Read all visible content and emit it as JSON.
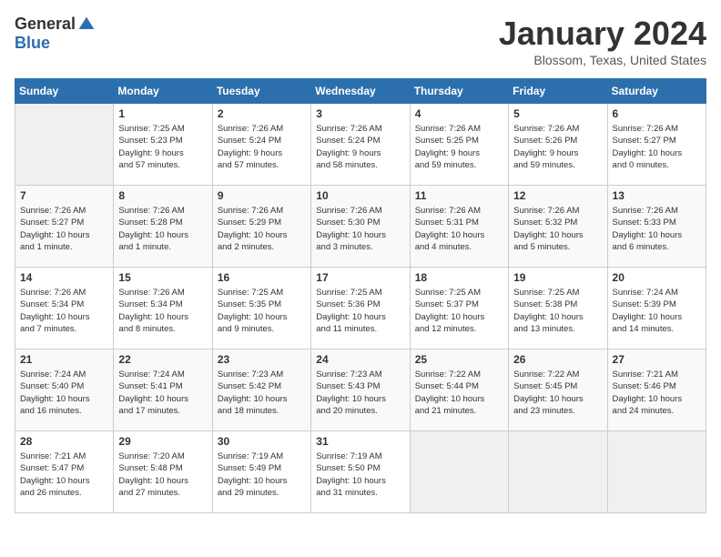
{
  "logo": {
    "general": "General",
    "blue": "Blue"
  },
  "title": "January 2024",
  "location": "Blossom, Texas, United States",
  "days_header": [
    "Sunday",
    "Monday",
    "Tuesday",
    "Wednesday",
    "Thursday",
    "Friday",
    "Saturday"
  ],
  "weeks": [
    [
      {
        "day": "",
        "info": ""
      },
      {
        "day": "1",
        "info": "Sunrise: 7:25 AM\nSunset: 5:23 PM\nDaylight: 9 hours\nand 57 minutes."
      },
      {
        "day": "2",
        "info": "Sunrise: 7:26 AM\nSunset: 5:24 PM\nDaylight: 9 hours\nand 57 minutes."
      },
      {
        "day": "3",
        "info": "Sunrise: 7:26 AM\nSunset: 5:24 PM\nDaylight: 9 hours\nand 58 minutes."
      },
      {
        "day": "4",
        "info": "Sunrise: 7:26 AM\nSunset: 5:25 PM\nDaylight: 9 hours\nand 59 minutes."
      },
      {
        "day": "5",
        "info": "Sunrise: 7:26 AM\nSunset: 5:26 PM\nDaylight: 9 hours\nand 59 minutes."
      },
      {
        "day": "6",
        "info": "Sunrise: 7:26 AM\nSunset: 5:27 PM\nDaylight: 10 hours\nand 0 minutes."
      }
    ],
    [
      {
        "day": "7",
        "info": "Sunrise: 7:26 AM\nSunset: 5:27 PM\nDaylight: 10 hours\nand 1 minute."
      },
      {
        "day": "8",
        "info": "Sunrise: 7:26 AM\nSunset: 5:28 PM\nDaylight: 10 hours\nand 1 minute."
      },
      {
        "day": "9",
        "info": "Sunrise: 7:26 AM\nSunset: 5:29 PM\nDaylight: 10 hours\nand 2 minutes."
      },
      {
        "day": "10",
        "info": "Sunrise: 7:26 AM\nSunset: 5:30 PM\nDaylight: 10 hours\nand 3 minutes."
      },
      {
        "day": "11",
        "info": "Sunrise: 7:26 AM\nSunset: 5:31 PM\nDaylight: 10 hours\nand 4 minutes."
      },
      {
        "day": "12",
        "info": "Sunrise: 7:26 AM\nSunset: 5:32 PM\nDaylight: 10 hours\nand 5 minutes."
      },
      {
        "day": "13",
        "info": "Sunrise: 7:26 AM\nSunset: 5:33 PM\nDaylight: 10 hours\nand 6 minutes."
      }
    ],
    [
      {
        "day": "14",
        "info": "Sunrise: 7:26 AM\nSunset: 5:34 PM\nDaylight: 10 hours\nand 7 minutes."
      },
      {
        "day": "15",
        "info": "Sunrise: 7:26 AM\nSunset: 5:34 PM\nDaylight: 10 hours\nand 8 minutes."
      },
      {
        "day": "16",
        "info": "Sunrise: 7:25 AM\nSunset: 5:35 PM\nDaylight: 10 hours\nand 9 minutes."
      },
      {
        "day": "17",
        "info": "Sunrise: 7:25 AM\nSunset: 5:36 PM\nDaylight: 10 hours\nand 11 minutes."
      },
      {
        "day": "18",
        "info": "Sunrise: 7:25 AM\nSunset: 5:37 PM\nDaylight: 10 hours\nand 12 minutes."
      },
      {
        "day": "19",
        "info": "Sunrise: 7:25 AM\nSunset: 5:38 PM\nDaylight: 10 hours\nand 13 minutes."
      },
      {
        "day": "20",
        "info": "Sunrise: 7:24 AM\nSunset: 5:39 PM\nDaylight: 10 hours\nand 14 minutes."
      }
    ],
    [
      {
        "day": "21",
        "info": "Sunrise: 7:24 AM\nSunset: 5:40 PM\nDaylight: 10 hours\nand 16 minutes."
      },
      {
        "day": "22",
        "info": "Sunrise: 7:24 AM\nSunset: 5:41 PM\nDaylight: 10 hours\nand 17 minutes."
      },
      {
        "day": "23",
        "info": "Sunrise: 7:23 AM\nSunset: 5:42 PM\nDaylight: 10 hours\nand 18 minutes."
      },
      {
        "day": "24",
        "info": "Sunrise: 7:23 AM\nSunset: 5:43 PM\nDaylight: 10 hours\nand 20 minutes."
      },
      {
        "day": "25",
        "info": "Sunrise: 7:22 AM\nSunset: 5:44 PM\nDaylight: 10 hours\nand 21 minutes."
      },
      {
        "day": "26",
        "info": "Sunrise: 7:22 AM\nSunset: 5:45 PM\nDaylight: 10 hours\nand 23 minutes."
      },
      {
        "day": "27",
        "info": "Sunrise: 7:21 AM\nSunset: 5:46 PM\nDaylight: 10 hours\nand 24 minutes."
      }
    ],
    [
      {
        "day": "28",
        "info": "Sunrise: 7:21 AM\nSunset: 5:47 PM\nDaylight: 10 hours\nand 26 minutes."
      },
      {
        "day": "29",
        "info": "Sunrise: 7:20 AM\nSunset: 5:48 PM\nDaylight: 10 hours\nand 27 minutes."
      },
      {
        "day": "30",
        "info": "Sunrise: 7:19 AM\nSunset: 5:49 PM\nDaylight: 10 hours\nand 29 minutes."
      },
      {
        "day": "31",
        "info": "Sunrise: 7:19 AM\nSunset: 5:50 PM\nDaylight: 10 hours\nand 31 minutes."
      },
      {
        "day": "",
        "info": ""
      },
      {
        "day": "",
        "info": ""
      },
      {
        "day": "",
        "info": ""
      }
    ]
  ]
}
